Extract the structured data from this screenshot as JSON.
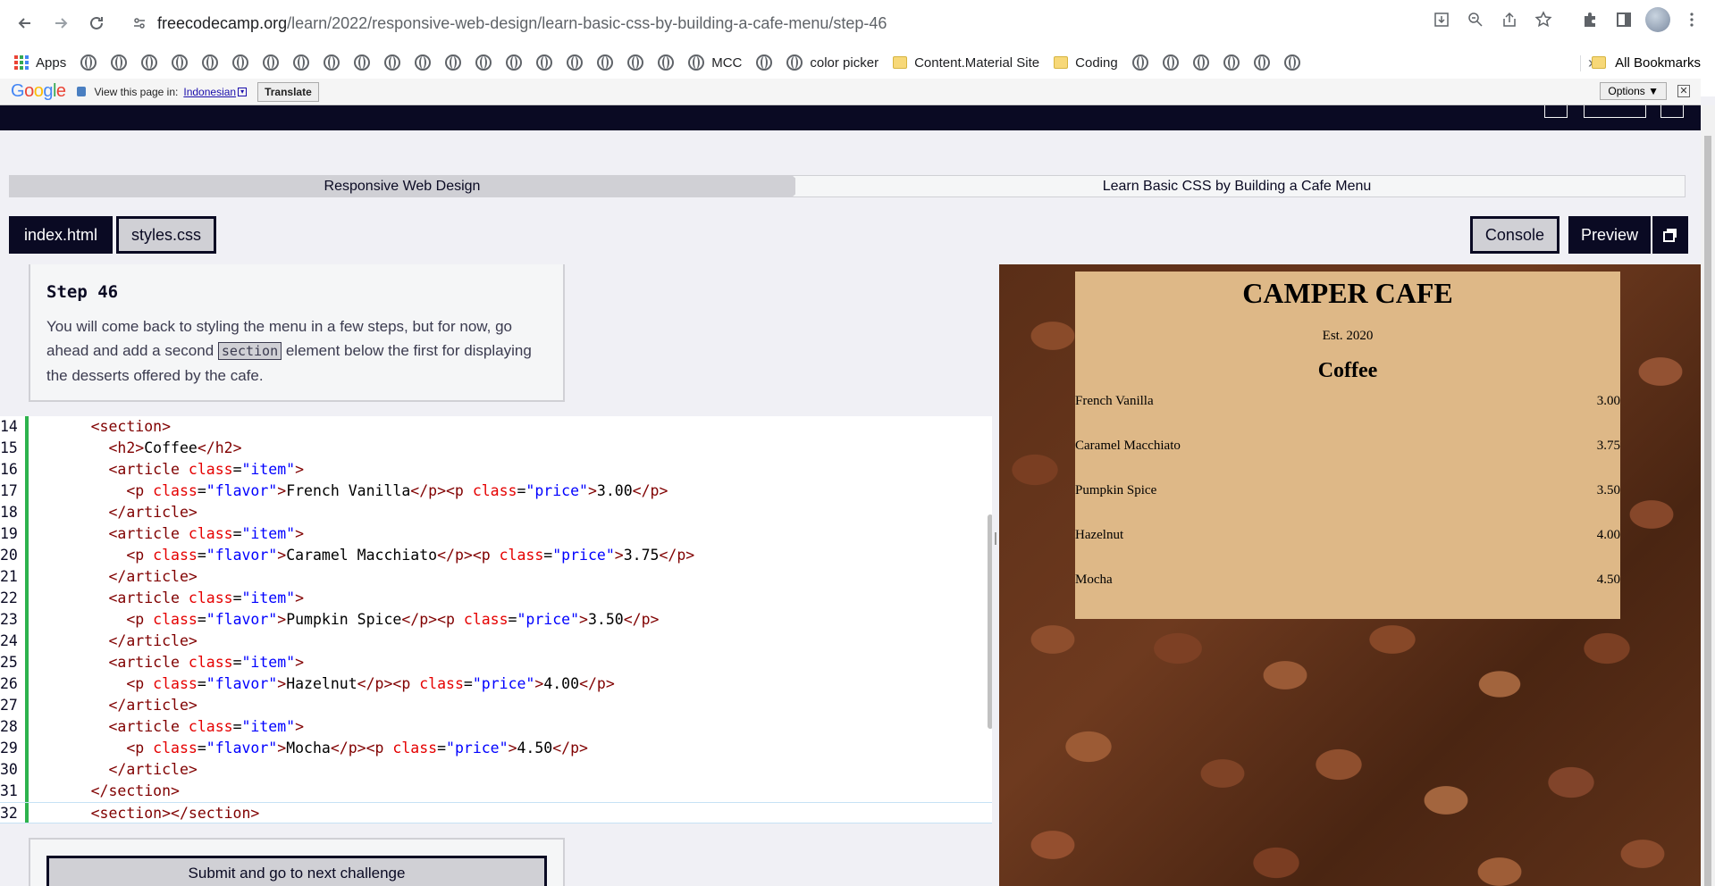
{
  "browser": {
    "url_host": "freecodecamp.org",
    "url_path": "/learn/2022/responsive-web-design/learn-basic-css-by-building-a-cafe-menu/step-46",
    "bookmarks": [
      {
        "label": "Apps",
        "icon": "apps-grid-icon"
      },
      {
        "label": "",
        "icon": "globe-icon"
      },
      {
        "label": "",
        "icon": "globe-icon"
      },
      {
        "label": "",
        "icon": "globe-icon"
      },
      {
        "label": "",
        "icon": "globe-icon"
      },
      {
        "label": "",
        "icon": "globe-icon"
      },
      {
        "label": "",
        "icon": "globe-icon"
      },
      {
        "label": "",
        "icon": "globe-icon"
      },
      {
        "label": "",
        "icon": "globe-icon"
      },
      {
        "label": "",
        "icon": "globe-icon"
      },
      {
        "label": "",
        "icon": "globe-icon"
      },
      {
        "label": "",
        "icon": "globe-icon"
      },
      {
        "label": "",
        "icon": "globe-icon"
      },
      {
        "label": "",
        "icon": "globe-icon"
      },
      {
        "label": "",
        "icon": "globe-icon"
      },
      {
        "label": "",
        "icon": "globe-icon"
      },
      {
        "label": "",
        "icon": "globe-icon"
      },
      {
        "label": "",
        "icon": "globe-icon"
      },
      {
        "label": "",
        "icon": "globe-icon"
      },
      {
        "label": "",
        "icon": "globe-icon"
      },
      {
        "label": "",
        "icon": "globe-icon"
      },
      {
        "label": "MCC",
        "icon": "globe-icon"
      },
      {
        "label": "",
        "icon": "globe-icon"
      },
      {
        "label": "color picker",
        "icon": "globe-icon"
      },
      {
        "label": "Content.Material Site",
        "icon": "folder-icon"
      },
      {
        "label": "Coding",
        "icon": "folder-icon"
      },
      {
        "label": "",
        "icon": "globe-icon"
      },
      {
        "label": "",
        "icon": "globe-icon"
      },
      {
        "label": "",
        "icon": "globe-icon"
      },
      {
        "label": "",
        "icon": "globe-icon"
      },
      {
        "label": "",
        "icon": "globe-icon"
      },
      {
        "label": "",
        "icon": "globe-icon"
      }
    ],
    "more_bookmarks": "»",
    "all_bookmarks": "All Bookmarks"
  },
  "translate": {
    "logo_parts": [
      "G",
      "o",
      "o",
      "g",
      "l",
      "e"
    ],
    "prompt": "View this page in:",
    "language": "Indonesian",
    "dropdown_glyph": "▾",
    "button": "Translate",
    "options": "Options ▼",
    "close": "✕"
  },
  "breadcrumb": {
    "superblock": "Responsive Web Design",
    "block": "Learn Basic CSS by Building a Cafe Menu"
  },
  "tabs": {
    "html": "index.html",
    "css": "styles.css",
    "console": "Console",
    "preview": "Preview"
  },
  "instructions": {
    "title": "Step 46",
    "text_before": "You will come back to styling the menu in a few steps, but for now, go ahead and add a second ",
    "code": "section",
    "text_after": " element below the first for displaying the desserts offered by the cafe."
  },
  "editor": {
    "lines": [
      {
        "n": "14",
        "indent": "      ",
        "tokens": [
          [
            "tag",
            "<section>"
          ]
        ]
      },
      {
        "n": "15",
        "indent": "        ",
        "tokens": [
          [
            "tag",
            "<h2>"
          ],
          [
            "txt",
            "Coffee"
          ],
          [
            "tag",
            "</h2>"
          ]
        ]
      },
      {
        "n": "16",
        "indent": "        ",
        "tokens": [
          [
            "tag",
            "<article "
          ],
          [
            "attr",
            "class"
          ],
          [
            "txt",
            "="
          ],
          [
            "str",
            "\"item\""
          ],
          [
            "tag",
            ">"
          ]
        ]
      },
      {
        "n": "17",
        "indent": "          ",
        "tokens": [
          [
            "tag",
            "<p "
          ],
          [
            "attr",
            "class"
          ],
          [
            "txt",
            "="
          ],
          [
            "str",
            "\"flavor\""
          ],
          [
            "tag",
            ">"
          ],
          [
            "txt",
            "French Vanilla"
          ],
          [
            "tag",
            "</p><p "
          ],
          [
            "attr",
            "class"
          ],
          [
            "txt",
            "="
          ],
          [
            "str",
            "\"price\""
          ],
          [
            "tag",
            ">"
          ],
          [
            "txt",
            "3.00"
          ],
          [
            "tag",
            "</p>"
          ]
        ]
      },
      {
        "n": "18",
        "indent": "        ",
        "tokens": [
          [
            "tag",
            "</article>"
          ]
        ]
      },
      {
        "n": "19",
        "indent": "        ",
        "tokens": [
          [
            "tag",
            "<article "
          ],
          [
            "attr",
            "class"
          ],
          [
            "txt",
            "="
          ],
          [
            "str",
            "\"item\""
          ],
          [
            "tag",
            ">"
          ]
        ]
      },
      {
        "n": "20",
        "indent": "          ",
        "tokens": [
          [
            "tag",
            "<p "
          ],
          [
            "attr",
            "class"
          ],
          [
            "txt",
            "="
          ],
          [
            "str",
            "\"flavor\""
          ],
          [
            "tag",
            ">"
          ],
          [
            "txt",
            "Caramel Macchiato"
          ],
          [
            "tag",
            "</p><p "
          ],
          [
            "attr",
            "class"
          ],
          [
            "txt",
            "="
          ],
          [
            "str",
            "\"price\""
          ],
          [
            "tag",
            ">"
          ],
          [
            "txt",
            "3.75"
          ],
          [
            "tag",
            "</p>"
          ]
        ]
      },
      {
        "n": "21",
        "indent": "        ",
        "tokens": [
          [
            "tag",
            "</article>"
          ]
        ]
      },
      {
        "n": "22",
        "indent": "        ",
        "tokens": [
          [
            "tag",
            "<article "
          ],
          [
            "attr",
            "class"
          ],
          [
            "txt",
            "="
          ],
          [
            "str",
            "\"item\""
          ],
          [
            "tag",
            ">"
          ]
        ]
      },
      {
        "n": "23",
        "indent": "          ",
        "tokens": [
          [
            "tag",
            "<p "
          ],
          [
            "attr",
            "class"
          ],
          [
            "txt",
            "="
          ],
          [
            "str",
            "\"flavor\""
          ],
          [
            "tag",
            ">"
          ],
          [
            "txt",
            "Pumpkin Spice"
          ],
          [
            "tag",
            "</p><p "
          ],
          [
            "attr",
            "class"
          ],
          [
            "txt",
            "="
          ],
          [
            "str",
            "\"price\""
          ],
          [
            "tag",
            ">"
          ],
          [
            "txt",
            "3.50"
          ],
          [
            "tag",
            "</p>"
          ]
        ]
      },
      {
        "n": "24",
        "indent": "        ",
        "tokens": [
          [
            "tag",
            "</article>"
          ]
        ]
      },
      {
        "n": "25",
        "indent": "        ",
        "tokens": [
          [
            "tag",
            "<article "
          ],
          [
            "attr",
            "class"
          ],
          [
            "txt",
            "="
          ],
          [
            "str",
            "\"item\""
          ],
          [
            "tag",
            ">"
          ]
        ]
      },
      {
        "n": "26",
        "indent": "          ",
        "tokens": [
          [
            "tag",
            "<p "
          ],
          [
            "attr",
            "class"
          ],
          [
            "txt",
            "="
          ],
          [
            "str",
            "\"flavor\""
          ],
          [
            "tag",
            ">"
          ],
          [
            "txt",
            "Hazelnut"
          ],
          [
            "tag",
            "</p><p "
          ],
          [
            "attr",
            "class"
          ],
          [
            "txt",
            "="
          ],
          [
            "str",
            "\"price\""
          ],
          [
            "tag",
            ">"
          ],
          [
            "txt",
            "4.00"
          ],
          [
            "tag",
            "</p>"
          ]
        ]
      },
      {
        "n": "27",
        "indent": "        ",
        "tokens": [
          [
            "tag",
            "</article>"
          ]
        ]
      },
      {
        "n": "28",
        "indent": "        ",
        "tokens": [
          [
            "tag",
            "<article "
          ],
          [
            "attr",
            "class"
          ],
          [
            "txt",
            "="
          ],
          [
            "str",
            "\"item\""
          ],
          [
            "tag",
            ">"
          ]
        ]
      },
      {
        "n": "29",
        "indent": "          ",
        "tokens": [
          [
            "tag",
            "<p "
          ],
          [
            "attr",
            "class"
          ],
          [
            "txt",
            "="
          ],
          [
            "str",
            "\"flavor\""
          ],
          [
            "tag",
            ">"
          ],
          [
            "txt",
            "Mocha"
          ],
          [
            "tag",
            "</p><p "
          ],
          [
            "attr",
            "class"
          ],
          [
            "txt",
            "="
          ],
          [
            "str",
            "\"price\""
          ],
          [
            "tag",
            ">"
          ],
          [
            "txt",
            "4.50"
          ],
          [
            "tag",
            "</p>"
          ]
        ]
      },
      {
        "n": "30",
        "indent": "        ",
        "tokens": [
          [
            "tag",
            "</article>"
          ]
        ]
      },
      {
        "n": "31",
        "indent": "      ",
        "tokens": [
          [
            "tag",
            "</section>"
          ]
        ]
      },
      {
        "n": "32",
        "indent": "      ",
        "tokens": [
          [
            "tag",
            "<section></section>"
          ]
        ],
        "current": true
      }
    ]
  },
  "submit": {
    "label": "Submit and go to next challenge"
  },
  "preview": {
    "title": "CAMPER CAFE",
    "est": "Est. 2020",
    "section_title": "Coffee",
    "items": [
      {
        "flavor": "French Vanilla",
        "price": "3.00"
      },
      {
        "flavor": "Caramel Macchiato",
        "price": "3.75"
      },
      {
        "flavor": "Pumpkin Spice",
        "price": "3.50"
      },
      {
        "flavor": "Hazelnut",
        "price": "4.00"
      },
      {
        "flavor": "Mocha",
        "price": "4.50"
      }
    ]
  },
  "colors": {
    "fcc_dark": "#0a0a23",
    "gutter_green": "#2eb34d",
    "menu_bg": "#deb887"
  }
}
